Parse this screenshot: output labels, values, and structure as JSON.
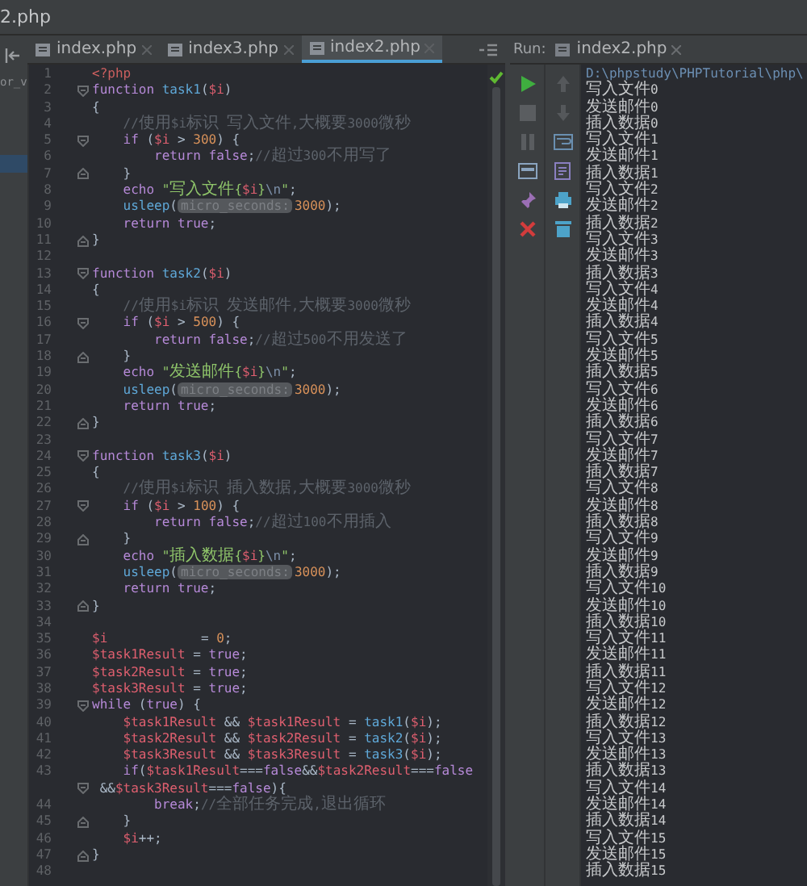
{
  "window": {
    "title": "2.php"
  },
  "sidebar": {
    "text": "or_v"
  },
  "tabs": [
    {
      "label": "index.php",
      "selected": false
    },
    {
      "label": "index3.php",
      "selected": false
    },
    {
      "label": "index2.php",
      "selected": true
    }
  ],
  "code": [
    {
      "number": "1",
      "tokens": [
        {
          "kind": "tag",
          "text": "<?php"
        }
      ]
    },
    {
      "number": "2",
      "fold_start": true,
      "tokens": [
        {
          "kind": "keyword",
          "text": "function "
        },
        {
          "kind": "function",
          "text": "task1"
        },
        {
          "kind": "plain",
          "text": "("
        },
        {
          "kind": "variable",
          "text": "$i"
        },
        {
          "kind": "plain",
          "text": ")"
        }
      ]
    },
    {
      "number": "3",
      "tokens": [
        {
          "kind": "plain",
          "text": "{"
        }
      ]
    },
    {
      "number": "4",
      "tokens": [
        {
          "kind": "comment",
          "text": "    //使用$i标识 写入文件,大概要3000微秒"
        }
      ]
    },
    {
      "number": "5",
      "fold_start": true,
      "tokens": [
        {
          "kind": "keyword",
          "text": "    if"
        },
        {
          "kind": "plain",
          "text": " ("
        },
        {
          "kind": "variable",
          "text": "$i"
        },
        {
          "kind": "plain",
          "text": " > "
        },
        {
          "kind": "number",
          "text": "300"
        },
        {
          "kind": "plain",
          "text": ") {"
        }
      ]
    },
    {
      "number": "6",
      "tokens": [
        {
          "kind": "keyword",
          "text": "        return false"
        },
        {
          "kind": "plain",
          "text": ";"
        },
        {
          "kind": "comment",
          "text": "//超过300不用写了"
        }
      ]
    },
    {
      "number": "7",
      "fold_end": true,
      "tokens": [
        {
          "kind": "plain",
          "text": "    }"
        }
      ]
    },
    {
      "number": "8",
      "tokens": [
        {
          "kind": "keyword",
          "text": "    echo "
        },
        {
          "kind": "string",
          "text": "\"写入文件{"
        },
        {
          "kind": "variable",
          "text": "$i"
        },
        {
          "kind": "string",
          "text": "}"
        },
        {
          "kind": "escape",
          "text": "\\n"
        },
        {
          "kind": "string",
          "text": "\""
        },
        {
          "kind": "plain",
          "text": ";"
        }
      ]
    },
    {
      "number": "9",
      "tokens": [
        {
          "kind": "function",
          "text": "    usleep"
        },
        {
          "kind": "plain",
          "text": "("
        },
        {
          "kind": "hint",
          "text": "micro_seconds:"
        },
        {
          "kind": "number",
          "text": "3000"
        },
        {
          "kind": "plain",
          "text": ");"
        }
      ]
    },
    {
      "number": "10",
      "tokens": [
        {
          "kind": "keyword",
          "text": "    return true"
        },
        {
          "kind": "plain",
          "text": ";"
        }
      ]
    },
    {
      "number": "11",
      "fold_end": true,
      "tokens": [
        {
          "kind": "plain",
          "text": "}"
        }
      ]
    },
    {
      "number": "12"
    },
    {
      "number": "13",
      "fold_start": true,
      "tokens": [
        {
          "kind": "keyword",
          "text": "function "
        },
        {
          "kind": "function",
          "text": "task2"
        },
        {
          "kind": "plain",
          "text": "("
        },
        {
          "kind": "variable",
          "text": "$i"
        },
        {
          "kind": "plain",
          "text": ")"
        }
      ]
    },
    {
      "number": "14",
      "tokens": [
        {
          "kind": "plain",
          "text": "{"
        }
      ]
    },
    {
      "number": "15",
      "tokens": [
        {
          "kind": "comment",
          "text": "    //使用$i标识 发送邮件,大概要3000微秒"
        }
      ]
    },
    {
      "number": "16",
      "fold_start": true,
      "tokens": [
        {
          "kind": "keyword",
          "text": "    if"
        },
        {
          "kind": "plain",
          "text": " ("
        },
        {
          "kind": "variable",
          "text": "$i"
        },
        {
          "kind": "plain",
          "text": " > "
        },
        {
          "kind": "number",
          "text": "500"
        },
        {
          "kind": "plain",
          "text": ") {"
        }
      ]
    },
    {
      "number": "17",
      "tokens": [
        {
          "kind": "keyword",
          "text": "        return false"
        },
        {
          "kind": "plain",
          "text": ";"
        },
        {
          "kind": "comment",
          "text": "//超过500不用发送了"
        }
      ]
    },
    {
      "number": "18",
      "fold_end": true,
      "tokens": [
        {
          "kind": "plain",
          "text": "    }"
        }
      ]
    },
    {
      "number": "19",
      "tokens": [
        {
          "kind": "keyword",
          "text": "    echo "
        },
        {
          "kind": "string",
          "text": "\"发送邮件{"
        },
        {
          "kind": "variable",
          "text": "$i"
        },
        {
          "kind": "string",
          "text": "}"
        },
        {
          "kind": "escape",
          "text": "\\n"
        },
        {
          "kind": "string",
          "text": "\""
        },
        {
          "kind": "plain",
          "text": ";"
        }
      ]
    },
    {
      "number": "20",
      "tokens": [
        {
          "kind": "function",
          "text": "    usleep"
        },
        {
          "kind": "plain",
          "text": "("
        },
        {
          "kind": "hint",
          "text": "micro_seconds:"
        },
        {
          "kind": "number",
          "text": "3000"
        },
        {
          "kind": "plain",
          "text": ");"
        }
      ]
    },
    {
      "number": "21",
      "tokens": [
        {
          "kind": "keyword",
          "text": "    return true"
        },
        {
          "kind": "plain",
          "text": ";"
        }
      ]
    },
    {
      "number": "22",
      "fold_end": true,
      "tokens": [
        {
          "kind": "plain",
          "text": "}"
        }
      ]
    },
    {
      "number": "23"
    },
    {
      "number": "24",
      "fold_start": true,
      "tokens": [
        {
          "kind": "keyword",
          "text": "function "
        },
        {
          "kind": "function",
          "text": "task3"
        },
        {
          "kind": "plain",
          "text": "("
        },
        {
          "kind": "variable",
          "text": "$i"
        },
        {
          "kind": "plain",
          "text": ")"
        }
      ]
    },
    {
      "number": "25",
      "tokens": [
        {
          "kind": "plain",
          "text": "{"
        }
      ]
    },
    {
      "number": "26",
      "tokens": [
        {
          "kind": "comment",
          "text": "    //使用$i标识 插入数据,大概要3000微秒"
        }
      ]
    },
    {
      "number": "27",
      "fold_start": true,
      "tokens": [
        {
          "kind": "keyword",
          "text": "    if"
        },
        {
          "kind": "plain",
          "text": " ("
        },
        {
          "kind": "variable",
          "text": "$i"
        },
        {
          "kind": "plain",
          "text": " > "
        },
        {
          "kind": "number",
          "text": "100"
        },
        {
          "kind": "plain",
          "text": ") {"
        }
      ]
    },
    {
      "number": "28",
      "tokens": [
        {
          "kind": "keyword",
          "text": "        return false"
        },
        {
          "kind": "plain",
          "text": ";"
        },
        {
          "kind": "comment",
          "text": "//超过100不用插入"
        }
      ]
    },
    {
      "number": "29",
      "fold_end": true,
      "tokens": [
        {
          "kind": "plain",
          "text": "    }"
        }
      ]
    },
    {
      "number": "30",
      "tokens": [
        {
          "kind": "keyword",
          "text": "    echo "
        },
        {
          "kind": "string",
          "text": "\"插入数据{"
        },
        {
          "kind": "variable",
          "text": "$i"
        },
        {
          "kind": "string",
          "text": "}"
        },
        {
          "kind": "escape",
          "text": "\\n"
        },
        {
          "kind": "string",
          "text": "\""
        },
        {
          "kind": "plain",
          "text": ";"
        }
      ]
    },
    {
      "number": "31",
      "tokens": [
        {
          "kind": "function",
          "text": "    usleep"
        },
        {
          "kind": "plain",
          "text": "("
        },
        {
          "kind": "hint",
          "text": "micro_seconds:"
        },
        {
          "kind": "number",
          "text": "3000"
        },
        {
          "kind": "plain",
          "text": ");"
        }
      ]
    },
    {
      "number": "32",
      "tokens": [
        {
          "kind": "keyword",
          "text": "    return true"
        },
        {
          "kind": "plain",
          "text": ";"
        }
      ]
    },
    {
      "number": "33",
      "fold_end": true,
      "tokens": [
        {
          "kind": "plain",
          "text": "}"
        }
      ]
    },
    {
      "number": "34"
    },
    {
      "number": "35",
      "tokens": [
        {
          "kind": "variable",
          "text": "$i"
        },
        {
          "kind": "plain",
          "text": "            = "
        },
        {
          "kind": "number",
          "text": "0"
        },
        {
          "kind": "plain",
          "text": ";"
        }
      ]
    },
    {
      "number": "36",
      "tokens": [
        {
          "kind": "variable",
          "text": "$task1Result"
        },
        {
          "kind": "plain",
          "text": " = "
        },
        {
          "kind": "keyword",
          "text": "true"
        },
        {
          "kind": "plain",
          "text": ";"
        }
      ]
    },
    {
      "number": "37",
      "tokens": [
        {
          "kind": "variable",
          "text": "$task2Result"
        },
        {
          "kind": "plain",
          "text": " = "
        },
        {
          "kind": "keyword",
          "text": "true"
        },
        {
          "kind": "plain",
          "text": ";"
        }
      ]
    },
    {
      "number": "38",
      "tokens": [
        {
          "kind": "variable",
          "text": "$task3Result"
        },
        {
          "kind": "plain",
          "text": " = "
        },
        {
          "kind": "keyword",
          "text": "true"
        },
        {
          "kind": "plain",
          "text": ";"
        }
      ]
    },
    {
      "number": "39",
      "fold_start": true,
      "tokens": [
        {
          "kind": "keyword",
          "text": "while"
        },
        {
          "kind": "plain",
          "text": " ("
        },
        {
          "kind": "keyword",
          "text": "true"
        },
        {
          "kind": "plain",
          "text": ") {"
        }
      ]
    },
    {
      "number": "40",
      "tokens": [
        {
          "kind": "variable",
          "text": "    $task1Result"
        },
        {
          "kind": "plain",
          "text": " && "
        },
        {
          "kind": "variable",
          "text": "$task1Result"
        },
        {
          "kind": "plain",
          "text": " = "
        },
        {
          "kind": "function",
          "text": "task1"
        },
        {
          "kind": "plain",
          "text": "("
        },
        {
          "kind": "variable",
          "text": "$i"
        },
        {
          "kind": "plain",
          "text": ");"
        }
      ]
    },
    {
      "number": "41",
      "tokens": [
        {
          "kind": "variable",
          "text": "    $task2Result"
        },
        {
          "kind": "plain",
          "text": " && "
        },
        {
          "kind": "variable",
          "text": "$task2Result"
        },
        {
          "kind": "plain",
          "text": " = "
        },
        {
          "kind": "function",
          "text": "task2"
        },
        {
          "kind": "plain",
          "text": "("
        },
        {
          "kind": "variable",
          "text": "$i"
        },
        {
          "kind": "plain",
          "text": ");"
        }
      ]
    },
    {
      "number": "42",
      "tokens": [
        {
          "kind": "variable",
          "text": "    $task3Result"
        },
        {
          "kind": "plain",
          "text": " && "
        },
        {
          "kind": "variable",
          "text": "$task3Result"
        },
        {
          "kind": "plain",
          "text": " = "
        },
        {
          "kind": "function",
          "text": "task3"
        },
        {
          "kind": "plain",
          "text": "("
        },
        {
          "kind": "variable",
          "text": "$i"
        },
        {
          "kind": "plain",
          "text": ");"
        }
      ]
    },
    {
      "number": "43",
      "tokens": [
        {
          "kind": "keyword",
          "text": "    if"
        },
        {
          "kind": "plain",
          "text": "("
        },
        {
          "kind": "variable",
          "text": "$task1Result"
        },
        {
          "kind": "plain",
          "text": "==="
        },
        {
          "kind": "keyword",
          "text": "false"
        },
        {
          "kind": "plain",
          "text": "&&"
        },
        {
          "kind": "variable",
          "text": "$task2Result"
        },
        {
          "kind": "plain",
          "text": "==="
        },
        {
          "kind": "keyword",
          "text": "false"
        }
      ]
    },
    {
      "fold_start": true,
      "tokens": [
        {
          "kind": "plain",
          "text": " &&"
        },
        {
          "kind": "variable",
          "text": "$task3Result"
        },
        {
          "kind": "plain",
          "text": "==="
        },
        {
          "kind": "keyword",
          "text": "false"
        },
        {
          "kind": "plain",
          "text": "){"
        }
      ]
    },
    {
      "number": "44",
      "tokens": [
        {
          "kind": "keyword",
          "text": "        break"
        },
        {
          "kind": "plain",
          "text": ";"
        },
        {
          "kind": "comment",
          "text": "//全部任务完成,退出循环"
        }
      ]
    },
    {
      "number": "45",
      "fold_end": true,
      "tokens": [
        {
          "kind": "plain",
          "text": "    }"
        }
      ]
    },
    {
      "number": "46",
      "tokens": [
        {
          "kind": "variable",
          "text": "    $i"
        },
        {
          "kind": "plain",
          "text": "++;"
        }
      ]
    },
    {
      "number": "47",
      "fold_end": true,
      "tokens": [
        {
          "kind": "plain",
          "text": "}"
        }
      ]
    },
    {
      "number": "48"
    }
  ],
  "run": {
    "label": "Run:",
    "tab": "index2.php",
    "output": [
      {
        "kind": "command",
        "text": "D:\\phpstudy\\PHPTutorial\\php\\"
      },
      {
        "kind": "stdout",
        "text": "写入文件0"
      },
      {
        "kind": "stdout",
        "text": "发送邮件0"
      },
      {
        "kind": "stdout",
        "text": "插入数据0"
      },
      {
        "kind": "stdout",
        "text": "写入文件1"
      },
      {
        "kind": "stdout",
        "text": "发送邮件1"
      },
      {
        "kind": "stdout",
        "text": "插入数据1"
      },
      {
        "kind": "stdout",
        "text": "写入文件2"
      },
      {
        "kind": "stdout",
        "text": "发送邮件2"
      },
      {
        "kind": "stdout",
        "text": "插入数据2"
      },
      {
        "kind": "stdout",
        "text": "写入文件3"
      },
      {
        "kind": "stdout",
        "text": "发送邮件3"
      },
      {
        "kind": "stdout",
        "text": "插入数据3"
      },
      {
        "kind": "stdout",
        "text": "写入文件4"
      },
      {
        "kind": "stdout",
        "text": "发送邮件4"
      },
      {
        "kind": "stdout",
        "text": "插入数据4"
      },
      {
        "kind": "stdout",
        "text": "写入文件5"
      },
      {
        "kind": "stdout",
        "text": "发送邮件5"
      },
      {
        "kind": "stdout",
        "text": "插入数据5"
      },
      {
        "kind": "stdout",
        "text": "写入文件6"
      },
      {
        "kind": "stdout",
        "text": "发送邮件6"
      },
      {
        "kind": "stdout",
        "text": "插入数据6"
      },
      {
        "kind": "stdout",
        "text": "写入文件7"
      },
      {
        "kind": "stdout",
        "text": "发送邮件7"
      },
      {
        "kind": "stdout",
        "text": "插入数据7"
      },
      {
        "kind": "stdout",
        "text": "写入文件8"
      },
      {
        "kind": "stdout",
        "text": "发送邮件8"
      },
      {
        "kind": "stdout",
        "text": "插入数据8"
      },
      {
        "kind": "stdout",
        "text": "写入文件9"
      },
      {
        "kind": "stdout",
        "text": "发送邮件9"
      },
      {
        "kind": "stdout",
        "text": "插入数据9"
      },
      {
        "kind": "stdout",
        "text": "写入文件10"
      },
      {
        "kind": "stdout",
        "text": "发送邮件10"
      },
      {
        "kind": "stdout",
        "text": "插入数据10"
      },
      {
        "kind": "stdout",
        "text": "写入文件11"
      },
      {
        "kind": "stdout",
        "text": "发送邮件11"
      },
      {
        "kind": "stdout",
        "text": "插入数据11"
      },
      {
        "kind": "stdout",
        "text": "写入文件12"
      },
      {
        "kind": "stdout",
        "text": "发送邮件12"
      },
      {
        "kind": "stdout",
        "text": "插入数据12"
      },
      {
        "kind": "stdout",
        "text": "写入文件13"
      },
      {
        "kind": "stdout",
        "text": "发送邮件13"
      },
      {
        "kind": "stdout",
        "text": "插入数据13"
      },
      {
        "kind": "stdout",
        "text": "写入文件14"
      },
      {
        "kind": "stdout",
        "text": "发送邮件14"
      },
      {
        "kind": "stdout",
        "text": "插入数据14"
      },
      {
        "kind": "stdout",
        "text": "写入文件15"
      },
      {
        "kind": "stdout",
        "text": "发送邮件15"
      },
      {
        "kind": "stdout",
        "text": "插入数据15"
      }
    ]
  }
}
